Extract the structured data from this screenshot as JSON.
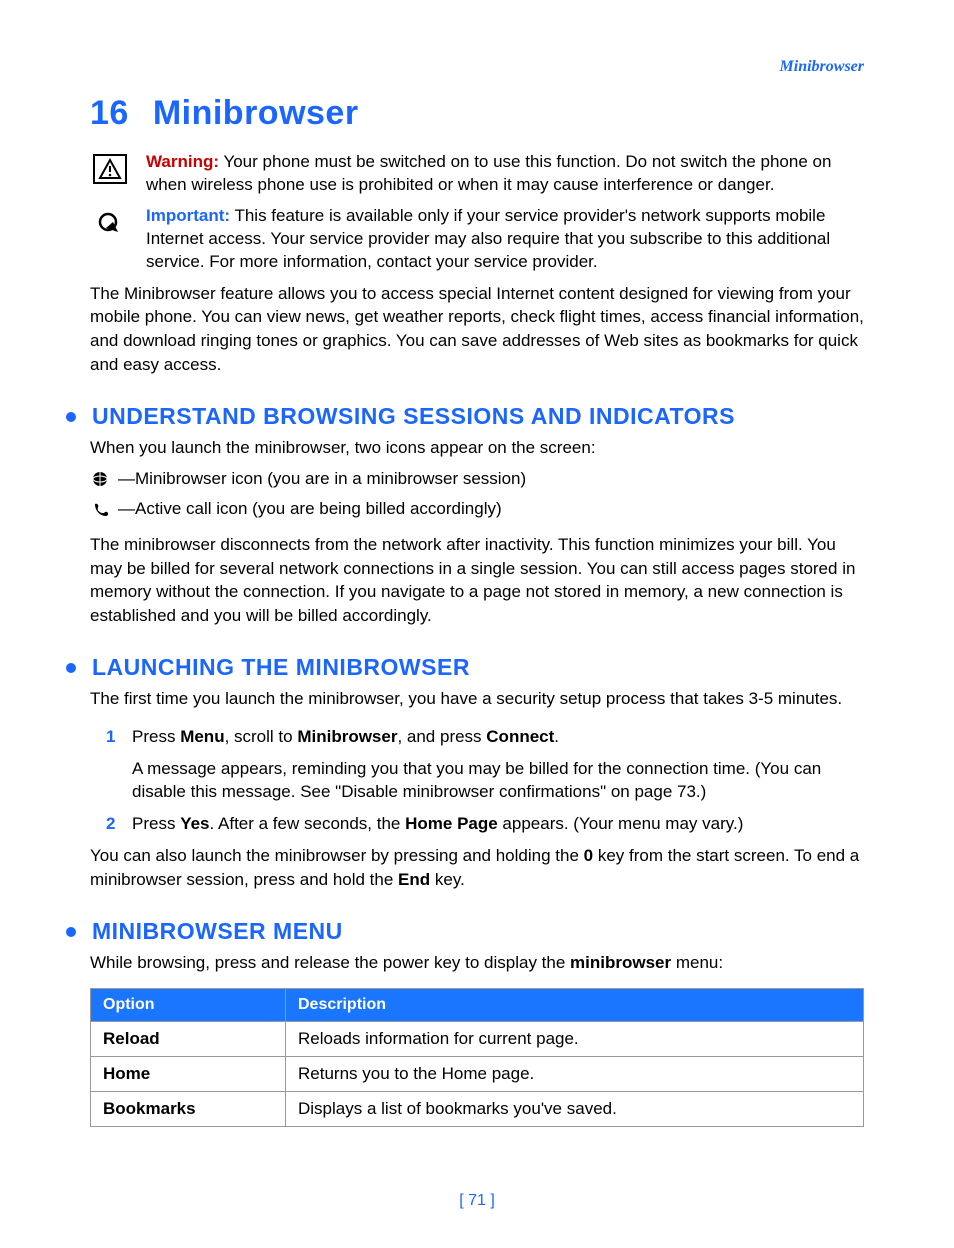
{
  "running_header": "Minibrowser",
  "chapter": {
    "number": "16",
    "title": "Minibrowser"
  },
  "warning": {
    "label": "Warning:",
    "text": " Your phone must be switched on to use this function. Do not switch the phone on when wireless phone use is prohibited or when it may cause interference or danger."
  },
  "important": {
    "label": "Important:",
    "text": " This feature is available only if your service provider's network supports mobile Internet access. Your service provider may also require that you subscribe to this additional service. For more information, contact your service provider."
  },
  "intro": "The Minibrowser feature allows you to access special Internet content designed for viewing from your mobile phone. You can view news, get weather reports, check flight times, access financial information, and download ringing tones or graphics. You can save addresses of Web sites as bookmarks for quick and easy access.",
  "sec1": {
    "title": "UNDERSTAND BROWSING SESSIONS AND INDICATORS",
    "lead": "When you launch the minibrowser, two icons appear on the screen:",
    "icon1": "—Minibrowser icon (you are in a minibrowser session)",
    "icon2": "—Active call icon (you are being billed accordingly)",
    "para": "The minibrowser disconnects from the network after inactivity. This function minimizes your bill. You may be billed for several network connections in a single session. You can still access pages stored in memory without the connection. If you navigate to a page not stored in memory, a new connection is established and you will be billed accordingly."
  },
  "sec2": {
    "title": "LAUNCHING THE MINIBROWSER",
    "lead": "The first time you launch the minibrowser, you have a security setup process that takes 3-5 minutes.",
    "steps": [
      {
        "n": "1",
        "pre": "Press ",
        "b1": "Menu",
        "mid1": ", scroll to ",
        "b2": "Minibrowser",
        "mid2": ", and press ",
        "b3": "Connect",
        "post": ".",
        "sub": "A message appears, reminding you that you may be billed for the connection time. (You can disable this message. See \"Disable minibrowser confirmations\" on page 73.)"
      },
      {
        "n": "2",
        "pre": "Press ",
        "b1": "Yes",
        "mid1": ". After a few seconds, the ",
        "b2": "Home Page",
        "mid2": " appears. (Your menu may vary.)",
        "b3": "",
        "post": ""
      }
    ],
    "tail_pre": "You can also launch the minibrowser by pressing and holding the ",
    "tail_b1": "0",
    "tail_mid": " key from the start screen. To end a minibrowser session, press and hold the ",
    "tail_b2": "End",
    "tail_post": " key."
  },
  "sec3": {
    "title": "MINIBROWSER MENU",
    "lead_pre": "While browsing, press and release the power key to display the ",
    "lead_b": "minibrowser",
    "lead_post": " menu:",
    "th1": "Option",
    "th2": "Description",
    "rows": [
      {
        "opt": "Reload",
        "desc": "Reloads information for current page."
      },
      {
        "opt": "Home",
        "desc": "Returns you to the Home page."
      },
      {
        "opt": "Bookmarks",
        "desc": "Displays a list of bookmarks you've saved."
      }
    ]
  },
  "page_number": "[ 71 ]"
}
